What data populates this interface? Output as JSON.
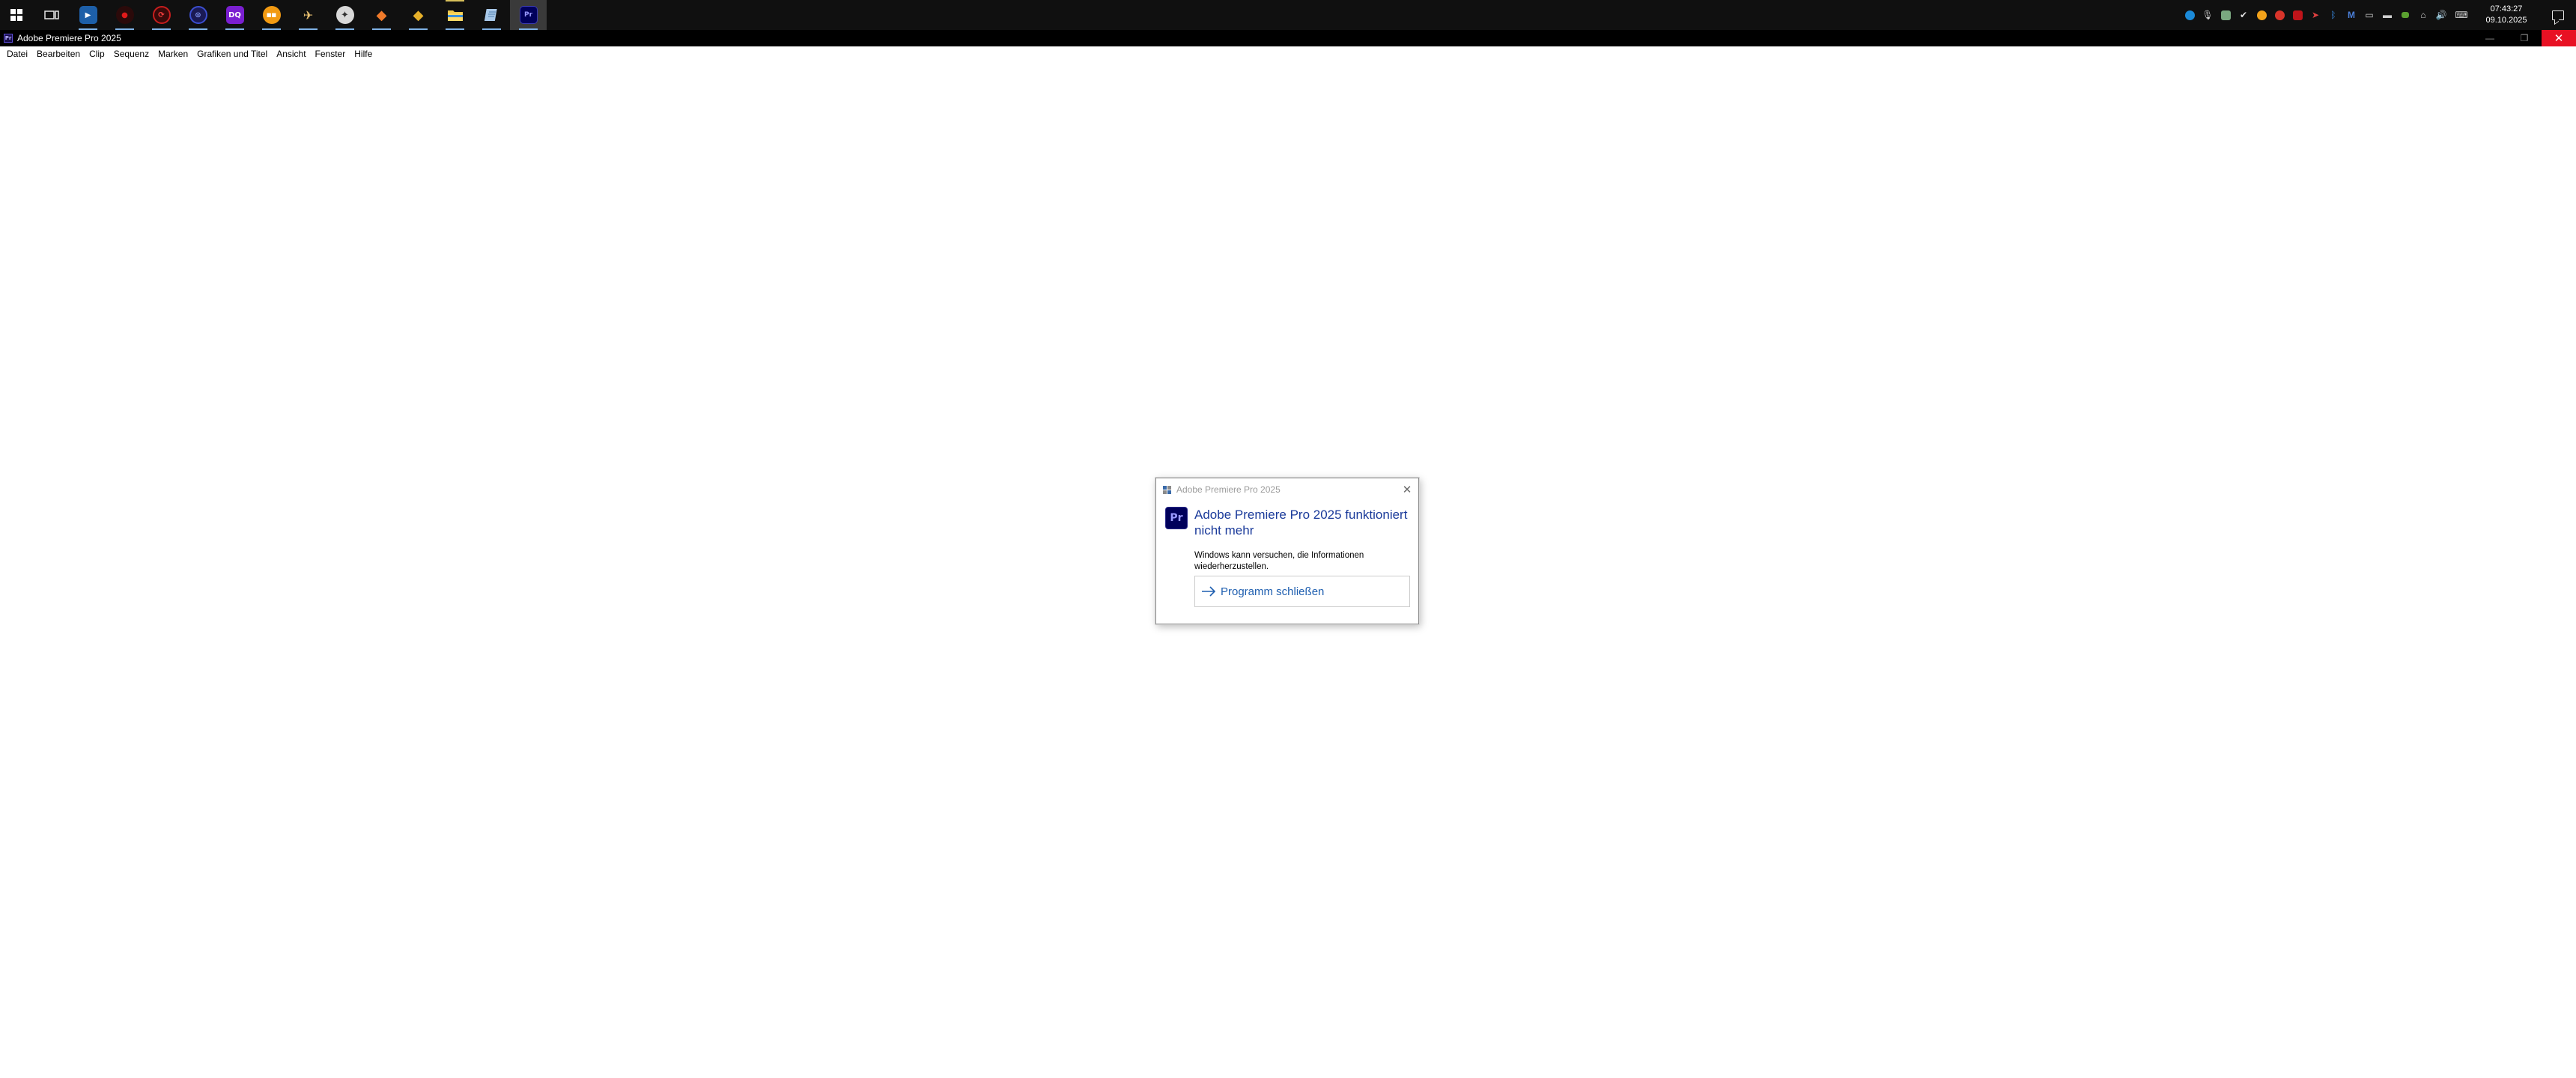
{
  "taskbar": {
    "apps": [
      {
        "name": "task-view",
        "label": ""
      },
      {
        "name": "media-player",
        "label": "▶"
      },
      {
        "name": "red-recorder",
        "label": "●"
      },
      {
        "name": "davinci-resolve",
        "label": "⟳"
      },
      {
        "name": "cyberlink",
        "label": "⊙"
      },
      {
        "name": "app-dq",
        "label": "DQ"
      },
      {
        "name": "orange-app",
        "label": "■■"
      },
      {
        "name": "plane-app",
        "label": "✈"
      },
      {
        "name": "stream-app",
        "label": "✦"
      },
      {
        "name": "orange-tool",
        "label": "◆"
      },
      {
        "name": "gold-tool",
        "label": "◆"
      },
      {
        "name": "file-explorer",
        "label": ""
      },
      {
        "name": "notepad",
        "label": ""
      },
      {
        "name": "premiere-pro",
        "label": "Pr"
      }
    ],
    "clock": {
      "time": "07:43:27",
      "date": "09.10.2025"
    }
  },
  "window": {
    "title": "Adobe Premiere Pro 2025",
    "icon_label": "Pr"
  },
  "menu": {
    "items": [
      "Datei",
      "Bearbeiten",
      "Clip",
      "Sequenz",
      "Marken",
      "Grafiken und Titel",
      "Ansicht",
      "Fenster",
      "Hilfe"
    ]
  },
  "dialog": {
    "title": "Adobe Premiere Pro 2025",
    "badge": "Pr",
    "heading": "Adobe Premiere Pro 2025 funktioniert nicht mehr",
    "message": "Windows kann versuchen, die Informationen wiederherzustellen.",
    "action": "Programm schließen"
  },
  "colors": {
    "taskbar": "#101010",
    "titlebar": "#000000",
    "close": "#e81123",
    "dialog_heading": "#1a3a9a",
    "dialog_action": "#1f5fb0",
    "premiere": "#00005b"
  }
}
